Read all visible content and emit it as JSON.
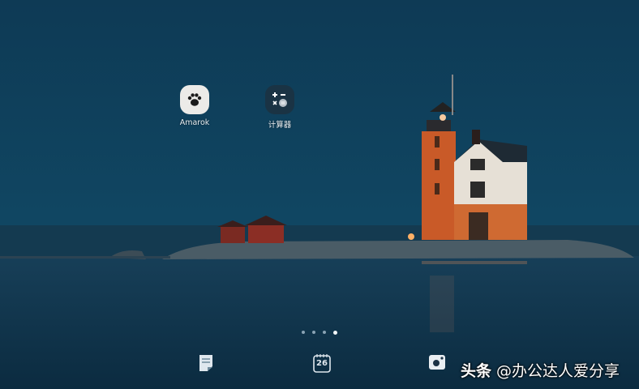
{
  "home": {
    "apps": [
      {
        "label": "Amarok",
        "icon": "paw-icon"
      },
      {
        "label": "计算器",
        "icon": "calculator-icon"
      }
    ],
    "page_indicator": {
      "total": 4,
      "current": 4
    },
    "dock": [
      {
        "icon": "notes-icon"
      },
      {
        "icon": "calendar-icon",
        "text": "26"
      },
      {
        "icon": "camera-icon"
      }
    ]
  },
  "watermark": {
    "brand": "头条",
    "handle": "@办公达人爱分享"
  },
  "colors": {
    "sky": "#0d3a55",
    "water": "#0e3048",
    "lighthouse": "#d0612b",
    "house": "#e6e0d6"
  }
}
